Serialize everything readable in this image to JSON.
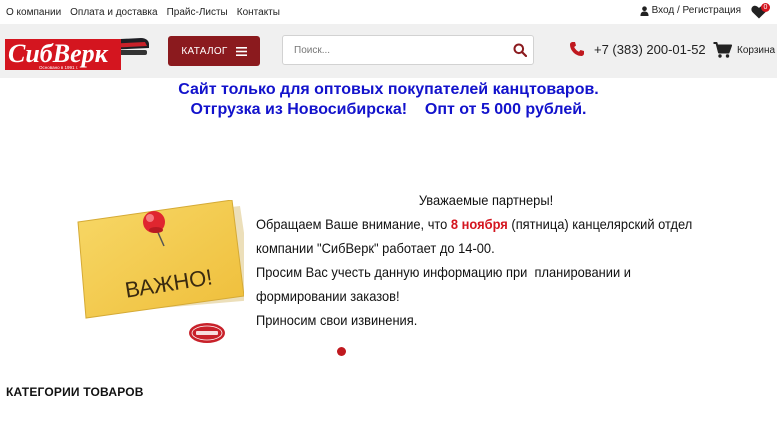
{
  "topnav": {
    "items": [
      "О компании",
      "Оплата и доставка",
      "Прайс-Листы",
      "Контакты"
    ],
    "login_label": "Вход / Регистрация",
    "favorites_count": "0"
  },
  "header": {
    "logo_text": "СибВерк",
    "logo_subtext": "Основано в 1991 г.",
    "catalog_label": "КАТАЛОГ",
    "search_placeholder": "Поиск...",
    "phone": "+7 (383) 200-01-52",
    "cart_label": "Корзина"
  },
  "announcement": {
    "line1": "Сайт только для оптовых покупателей канцтоваров.",
    "line2": "Отгрузка из Новосибирска!    Опт от 5 000 рублей."
  },
  "banner": {
    "note_text": "ВАЖНО!",
    "greeting": "Уважаемые партнеры!",
    "line1_pre": "Обращаем Ваше внимание, что ",
    "line1_highlight": "8 ноября",
    "line1_post": " (пятница) канцелярский отдел",
    "line2": "компании \"СибВерк\" работает до 14-00.",
    "line3": "Просим Вас учесть данную информацию при  планировании и",
    "line4": "формировании заказов!",
    "line5": "Приносим свои извинения."
  },
  "sections": {
    "categories_title": "КАТЕГОРИИ ТОВАРОВ"
  },
  "colors": {
    "brand_red": "#8b1a1e",
    "accent_red": "#d4151f",
    "announce_blue": "#1212cc",
    "note_yellow": "#f4cd4e"
  }
}
